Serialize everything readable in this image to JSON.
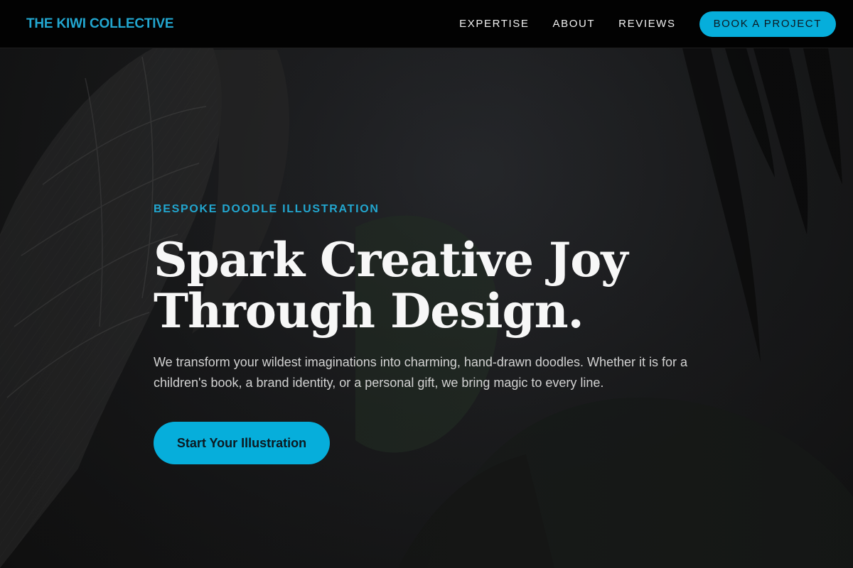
{
  "brand": {
    "name": "THE KIWI COLLECTIVE",
    "accent_color": "#06aedb"
  },
  "nav": {
    "links": [
      "EXPERTISE",
      "ABOUT",
      "REVIEWS"
    ],
    "cta_label": "BOOK A PROJECT"
  },
  "hero": {
    "eyebrow": "BESPOKE DOODLE ILLUSTRATION",
    "headline_line1": "Spark Creative Joy",
    "headline_line2": "Through Design.",
    "subtext": "We transform your wildest imaginations into charming, hand-drawn doodles. Whether it is for a children's book, a brand identity, or a personal gift, we bring magic to every line.",
    "cta_label": "Start Your Illustration",
    "background_image": "dark-illustrated-artwork"
  }
}
